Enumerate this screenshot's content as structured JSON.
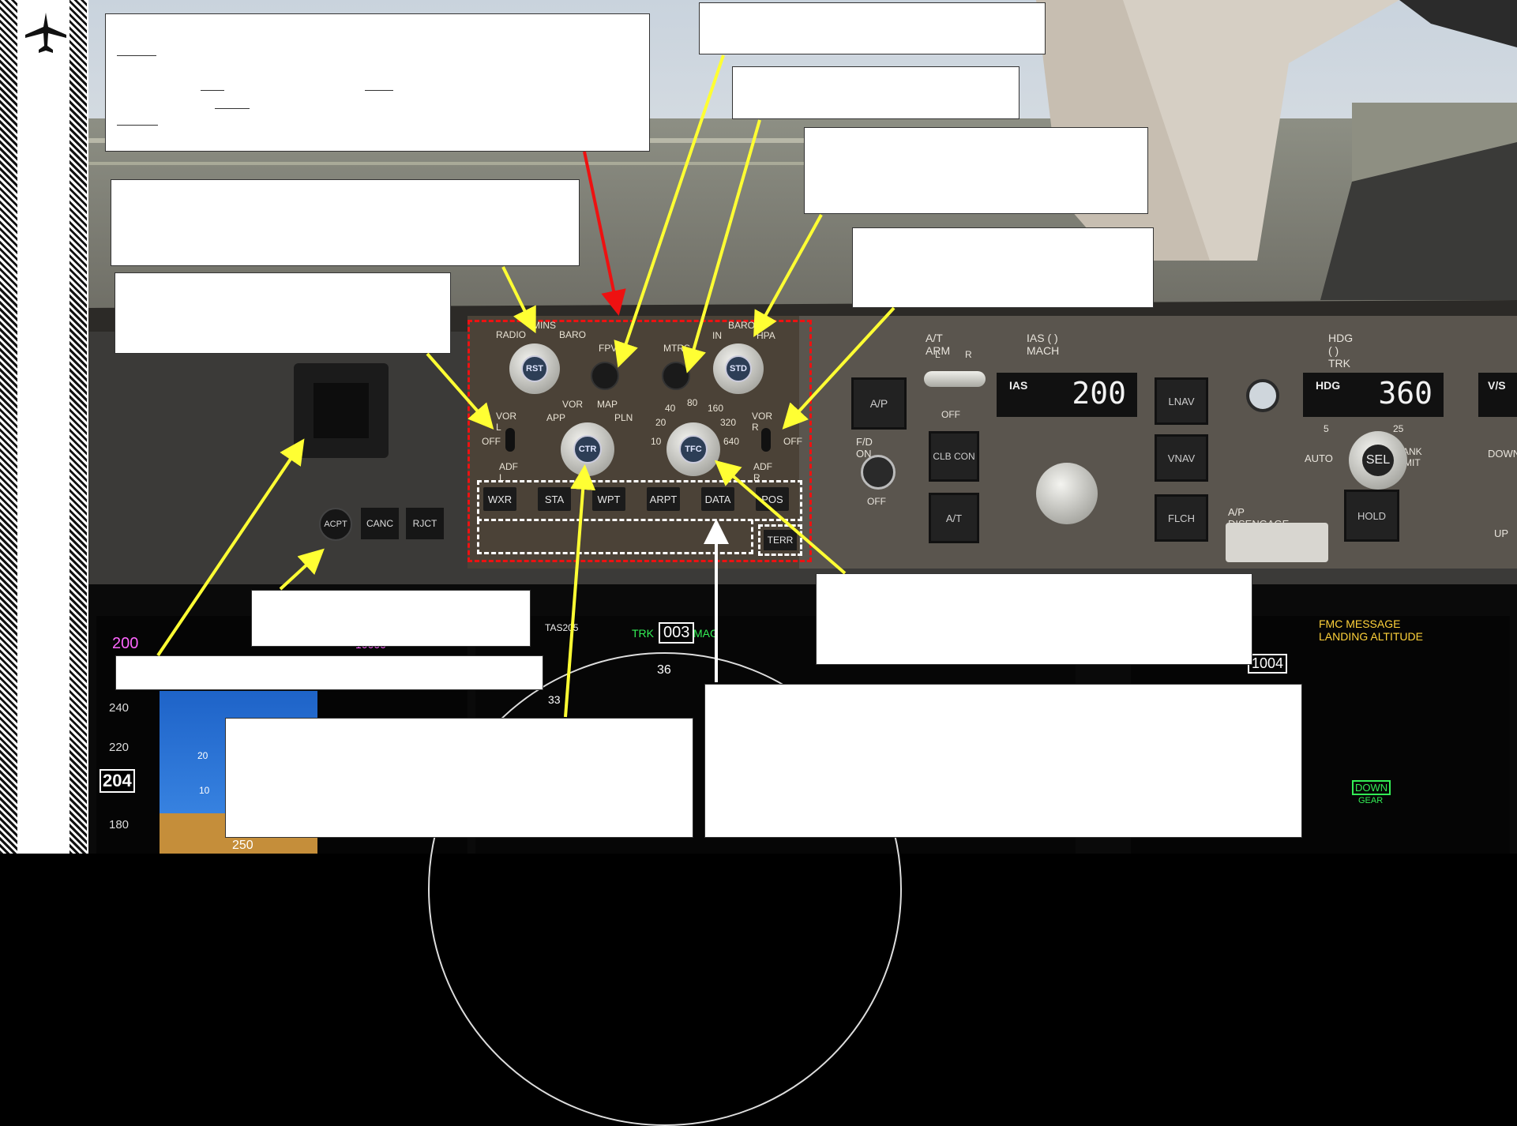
{
  "efis": {
    "minimums_labels": [
      "RADIO",
      "MINS",
      "BARO"
    ],
    "rst_label": "RST",
    "fpv_label": "FPV",
    "mtrs_label": "MTRS",
    "baro_labels": [
      "IN",
      "BARO",
      "HPA"
    ],
    "std_label": "STD",
    "vor_l": [
      "VOR L",
      "OFF",
      "ADF L"
    ],
    "vor_r": [
      "VOR R",
      "OFF",
      "ADF R"
    ],
    "mode_labels": [
      "APP",
      "VOR",
      "MAP",
      "PLN"
    ],
    "ctr_label": "CTR",
    "range_labels": [
      "10",
      "20",
      "40",
      "80",
      "160",
      "320",
      "640"
    ],
    "tfc_label": "TFC",
    "buttons": [
      "WXR",
      "STA",
      "WPT",
      "ARPT",
      "DATA",
      "POS"
    ],
    "terr_label": "TERR"
  },
  "alert_buttons": [
    "ACPT",
    "CANC",
    "RJCT"
  ],
  "mcp": {
    "at_arm": "A/T ARM",
    "at_arm_lr": [
      "L",
      "R"
    ],
    "at_arm_off": "OFF",
    "ias_mach_label": "IAS ( ) MACH",
    "ias_window_label": "IAS",
    "ias_value": "200",
    "hdg_trk_label": "HDG ( ) TRK",
    "hdg_window_label": "HDG",
    "hdg_value": "360",
    "vs_label": "V/S",
    "fd_on": "F/D ON",
    "fd_off": "OFF",
    "buttons": {
      "ap": "A/P",
      "clb_con": "CLB CON",
      "at": "A/T",
      "lnav": "LNAV",
      "vnav": "VNAV",
      "flch": "FLCH",
      "hold": "HOLD"
    },
    "auto_label": "AUTO",
    "sel_label": "SEL",
    "bank_limit": "BANK LIMIT",
    "bank_marks": [
      "5",
      "25"
    ],
    "ap_disengage": "A/P DISENGAGE",
    "down_label": "DOWN",
    "up_label": "UP"
  },
  "pfd": {
    "speed_readout": "200",
    "speed_current": "204",
    "speed_ticks": [
      "240",
      "220",
      "180"
    ],
    "bottom_value": "250",
    "pitch_mark": "20",
    "pitch_mark_2": "10",
    "top_value": "10000"
  },
  "nd": {
    "tas": "TAS205",
    "trk": "TRK",
    "trk_value": "003",
    "mag": "MAG",
    "compass_36": "36",
    "compass_33": "33"
  },
  "eicas": {
    "fmc_message_1": "FMC MESSAGE",
    "fmc_message_2": "LANDING ALTITUDE",
    "value_1004": "1004",
    "gear_down": "DOWN",
    "gear_label": "GEAR"
  },
  "colors": {
    "panel": "#4b4237",
    "mcp": "#5a554e",
    "annotation_yellow": "#ffff33",
    "annotation_red": "#ee1111",
    "efis_outline": "#ee1111",
    "pfd_magenta": "#ff66ff",
    "pfd_green": "#33ee55"
  }
}
